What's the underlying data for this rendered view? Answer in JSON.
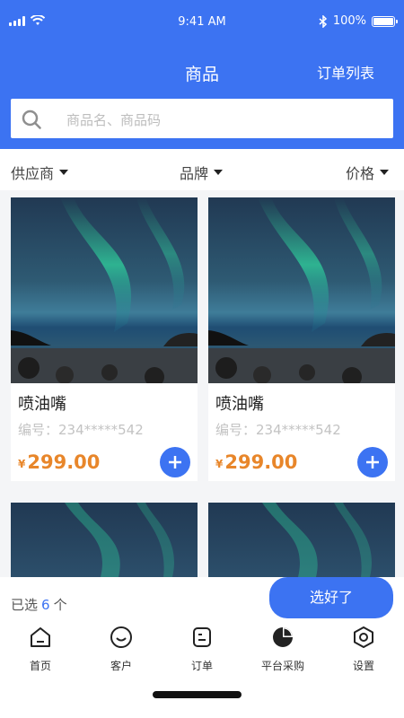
{
  "status_bar": {
    "time": "9:41 AM",
    "battery": "100%"
  },
  "header": {
    "title": "商品",
    "orders_link": "订单列表"
  },
  "search": {
    "placeholder": "商品名、商品码"
  },
  "filters": [
    "供应商",
    "品牌",
    "价格"
  ],
  "products": [
    {
      "name": "喷油嘴",
      "code": "编号：234*****542",
      "currency": "¥",
      "price": "299.00"
    },
    {
      "name": "喷油嘴",
      "code": "编号：234*****542",
      "currency": "¥",
      "price": "299.00"
    },
    {
      "name": "",
      "code": "",
      "currency": "",
      "price": ""
    },
    {
      "name": "",
      "code": "",
      "currency": "",
      "price": ""
    }
  ],
  "selection": {
    "label": "已选",
    "count": "6",
    "unit": "个",
    "confirm": "选好了"
  },
  "tabs": [
    {
      "label": "首页",
      "icon": "home-icon"
    },
    {
      "label": "客户",
      "icon": "customer-icon"
    },
    {
      "label": "订单",
      "icon": "order-icon"
    },
    {
      "label": "平台采购",
      "icon": "pie-chart-icon"
    },
    {
      "label": "设置",
      "icon": "settings-icon"
    }
  ],
  "colors": {
    "primary": "#3c73f2",
    "price": "#e8862a"
  }
}
